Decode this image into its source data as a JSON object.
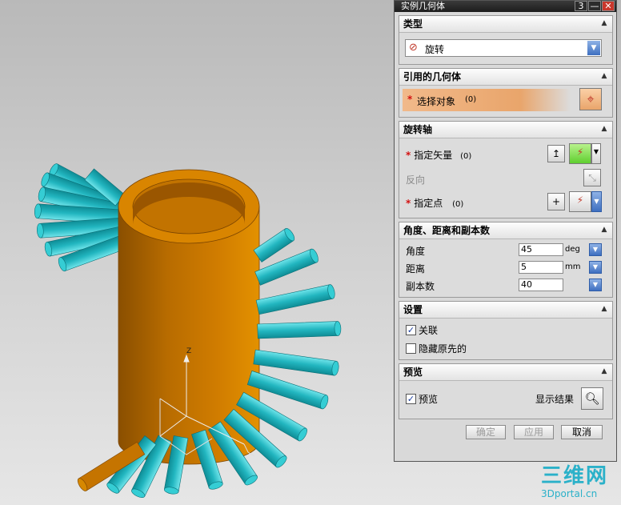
{
  "dialog": {
    "title": "实例几何体",
    "titlebar_buttons": [
      "3",
      "—",
      "✕"
    ]
  },
  "sections": {
    "type": {
      "header": "类型",
      "dropdown_value": "旋转"
    },
    "ref_geometry": {
      "header": "引用的几何体",
      "select_label": "选择对象",
      "select_count": "(0)"
    },
    "axis": {
      "header": "旋转轴",
      "vector_label": "指定矢量",
      "vector_count": "(0)",
      "reverse_label": "反向",
      "point_label": "指定点",
      "point_count": "(0)"
    },
    "params": {
      "header": "角度、距离和副本数",
      "angle_label": "角度",
      "angle_value": "45",
      "angle_unit": "deg",
      "distance_label": "距离",
      "distance_value": "5",
      "distance_unit": "mm",
      "copies_label": "副本数",
      "copies_value": "40"
    },
    "settings": {
      "header": "设置",
      "associative_label": "关联",
      "associative_checked": true,
      "hide_original_label": "隐藏原先的",
      "hide_original_checked": false
    },
    "preview": {
      "header": "预览",
      "preview_label": "预览",
      "preview_checked": true,
      "show_result_label": "显示结果"
    }
  },
  "footer": {
    "ok": "确定",
    "apply": "应用",
    "cancel": "取消"
  },
  "viewport": {
    "axis_label": "Z"
  },
  "watermark": {
    "brand": "三维网",
    "url": "3Dportal.cn"
  },
  "colors": {
    "accent_blue": "#2f5da8",
    "cylinder": "#d07c00",
    "rods": "#2ac1c8",
    "select_highlight": "#e9a56b"
  }
}
